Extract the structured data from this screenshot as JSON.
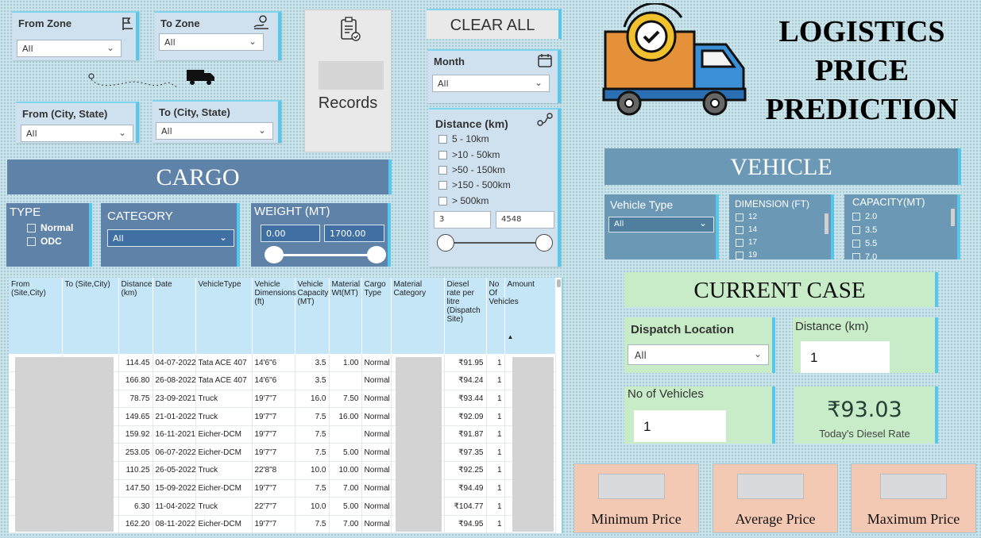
{
  "filters": {
    "from_zone": {
      "label": "From Zone",
      "value": "All"
    },
    "to_zone": {
      "label": "To Zone",
      "value": "All"
    },
    "from_city": {
      "label": "From (City, State)",
      "value": "All"
    },
    "to_city": {
      "label": "To (City, State)",
      "value": "All"
    },
    "month": {
      "label": "Month",
      "value": "All"
    },
    "clear_all": "CLEAR ALL",
    "records_label": "Records"
  },
  "distance": {
    "label": "Distance (km)",
    "options": [
      "5 - 10km",
      ">10 - 50km",
      ">50 - 150km",
      ">150 - 500km",
      "> 500km"
    ],
    "min": "3",
    "max": "4548"
  },
  "header": {
    "line1": "LOGISTICS",
    "line2": "PRICE",
    "line3": "PREDICTION"
  },
  "cargo": {
    "title": "CARGO",
    "type_label": "TYPE",
    "type_options": [
      "Normal",
      "ODC"
    ],
    "category_label": "CATEGORY",
    "category_value": "All",
    "weight_label": "WEIGHT (MT)",
    "weight_min": "0.00",
    "weight_max": "1700.00"
  },
  "vehicle": {
    "title": "VEHICLE",
    "type_label": "Vehicle Type",
    "type_value": "All",
    "dimension_label": "DIMENSION (FT)",
    "dimension_options": [
      "12",
      "14",
      "17",
      "19"
    ],
    "capacity_label": "CAPACITY(MT)",
    "capacity_options": [
      "2.0",
      "3.5",
      "5.5",
      "7.0"
    ]
  },
  "current_case": {
    "title": "CURRENT CASE",
    "dispatch_label": "Dispatch Location",
    "dispatch_value": "All",
    "distance_label": "Distance (km)",
    "distance_value": "1",
    "vehicles_label": "No of Vehicles",
    "vehicles_value": "1",
    "diesel_value": "₹93.03",
    "diesel_label": "Today's Diesel Rate"
  },
  "prices": {
    "min": "Minimum  Price",
    "avg": "Average  Price",
    "max": "Maximum  Price"
  },
  "table": {
    "headers": [
      "From (Site,City)",
      "To (Site,City)",
      "Distance (km)",
      "Date",
      "VehicleType",
      "Vehicle Dimensions (ft)",
      "Vehicle Capacity (MT)",
      "Material Wt(MT)",
      "Cargo Type",
      "Material Category",
      "Diesel rate per litre (Dispatch Site)",
      "No Of Vehicles",
      "Amount"
    ],
    "rows": [
      [
        "114.45",
        "04-07-2022",
        "Tata ACE 407",
        "14'6\"6",
        "3.5",
        "1.00",
        "Normal",
        "₹91.95",
        "1"
      ],
      [
        "166.80",
        "26-08-2022",
        "Tata ACE 407",
        "14'6\"6",
        "3.5",
        "",
        "Normal",
        "₹94.24",
        "1"
      ],
      [
        "78.75",
        "23-09-2021",
        "Truck",
        "19'7\"7",
        "16.0",
        "7.50",
        "Normal",
        "₹93.44",
        "1"
      ],
      [
        "149.65",
        "21-01-2022",
        "Truck",
        "19'7\"7",
        "7.5",
        "16.00",
        "Normal",
        "₹92.09",
        "1"
      ],
      [
        "159.92",
        "16-11-2021",
        "Eicher-DCM",
        "19'7\"7",
        "7.5",
        "",
        "Normal",
        "₹91.87",
        "1"
      ],
      [
        "253.05",
        "06-07-2022",
        "Eicher-DCM",
        "19'7\"7",
        "7.5",
        "5.00",
        "Normal",
        "₹97.35",
        "1"
      ],
      [
        "110.25",
        "26-05-2022",
        "Truck",
        "22'8\"8",
        "10.0",
        "10.00",
        "Normal",
        "₹92.25",
        "1"
      ],
      [
        "147.50",
        "15-09-2022",
        "Eicher-DCM",
        "19'7\"7",
        "7.5",
        "7.00",
        "Normal",
        "₹94.49",
        "1"
      ],
      [
        "6.30",
        "11-04-2022",
        "Truck",
        "22'7\"7",
        "10.0",
        "5.00",
        "Normal",
        "₹104.77",
        "1"
      ],
      [
        "162.20",
        "08-11-2022",
        "Eicher-DCM",
        "19'7\"7",
        "7.5",
        "7.00",
        "Normal",
        "₹94.95",
        "1"
      ]
    ]
  }
}
